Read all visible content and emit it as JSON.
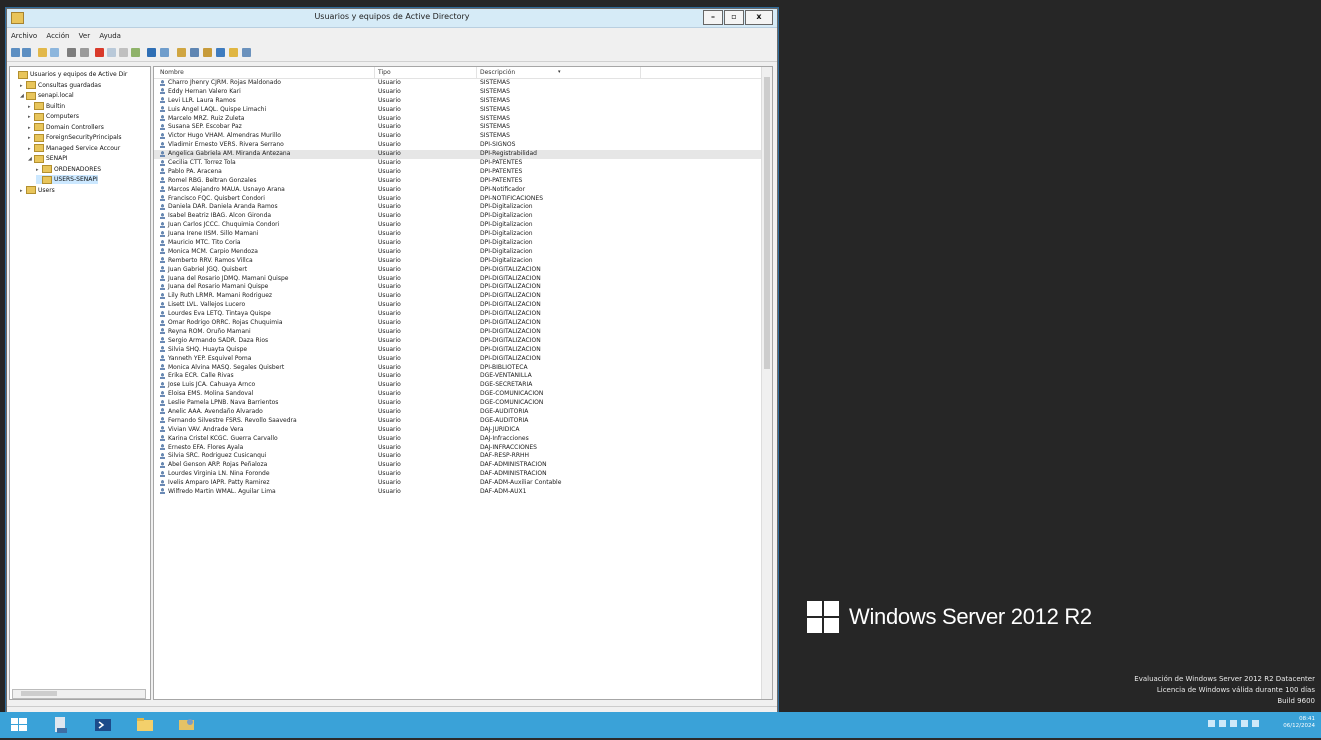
{
  "window": {
    "title": "Usuarios y equipos de Active Directory",
    "controls": {
      "minimize": "–",
      "maximize": "▫",
      "close": "x"
    }
  },
  "menu": [
    "Archivo",
    "Acción",
    "Ver",
    "Ayuda"
  ],
  "toolbar_icons": [
    "back-icon",
    "forward-icon",
    "folder-up-icon",
    "show-hide-tree-icon",
    "properties-icon",
    "copy-icon",
    "delete-icon",
    "refresh-icon",
    "export-icon",
    "help-icon",
    "filter-icon",
    "find-icon",
    "new-user-icon",
    "new-group-icon",
    "new-ou-icon",
    "filter-options-icon",
    "add-to-group-icon",
    "delegate-icon"
  ],
  "tree": {
    "items": [
      {
        "label": "Usuarios y equipos de Active Dir",
        "indent": 0,
        "expander": "",
        "selected": false
      },
      {
        "label": "Consultas guardadas",
        "indent": 1,
        "expander": "▸",
        "selected": false
      },
      {
        "label": "senapi.local",
        "indent": 1,
        "expander": "◢",
        "selected": false
      },
      {
        "label": "Builtin",
        "indent": 2,
        "expander": "▸",
        "selected": false
      },
      {
        "label": "Computers",
        "indent": 2,
        "expander": "▸",
        "selected": false
      },
      {
        "label": "Domain Controllers",
        "indent": 2,
        "expander": "▸",
        "selected": false
      },
      {
        "label": "ForeignSecurityPrincipals",
        "indent": 2,
        "expander": "▸",
        "selected": false
      },
      {
        "label": "Managed Service Accour",
        "indent": 2,
        "expander": "▸",
        "selected": false
      },
      {
        "label": "SENAPI",
        "indent": 2,
        "expander": "◢",
        "selected": false
      },
      {
        "label": "ORDENADORES",
        "indent": 3,
        "expander": "▸",
        "selected": false
      },
      {
        "label": "USERS-SENAPI",
        "indent": 3,
        "expander": "",
        "selected": true
      },
      {
        "label": "Users",
        "indent": 1,
        "expander": "▸",
        "selected": false
      }
    ]
  },
  "list": {
    "columns": {
      "name": "Nombre",
      "type": "Tipo",
      "desc": "Descripción"
    },
    "rows": [
      {
        "name": "Charro Jhenry CJRM. Rojas Maldonado",
        "type": "Usuario",
        "desc": "SISTEMAS"
      },
      {
        "name": "Eddy Hernan Valero Kari",
        "type": "Usuario",
        "desc": "SISTEMAS"
      },
      {
        "name": "Levi LLR. Laura Ramos",
        "type": "Usuario",
        "desc": "SISTEMAS"
      },
      {
        "name": "Luis Angel LAQL. Quispe Limachi",
        "type": "Usuario",
        "desc": "SISTEMAS"
      },
      {
        "name": "Marcelo MRZ. Ruiz Zuleta",
        "type": "Usuario",
        "desc": "SISTEMAS"
      },
      {
        "name": "Susana SEP. Escobar Paz",
        "type": "Usuario",
        "desc": "SISTEMAS"
      },
      {
        "name": "Victor Hugo VHAM. Almendras Murillo",
        "type": "Usuario",
        "desc": "SISTEMAS"
      },
      {
        "name": "Vladimir Ernesto VERS. Rivera Serrano",
        "type": "Usuario",
        "desc": "DPI-SIGNOS"
      },
      {
        "name": "Angelica Gabriela AM. Miranda Antezana",
        "type": "Usuario",
        "desc": "DPI-Registrabilidad"
      },
      {
        "name": "Cecilia CTT. Torrez Tola",
        "type": "Usuario",
        "desc": "DPI-PATENTES"
      },
      {
        "name": "Pablo PA. Aracena",
        "type": "Usuario",
        "desc": "DPI-PATENTES"
      },
      {
        "name": "Romel RBG. Beltran Gonzales",
        "type": "Usuario",
        "desc": "DPI-PATENTES"
      },
      {
        "name": "Marcos Alejandro MAUA. Usnayo Arana",
        "type": "Usuario",
        "desc": "DPI-Notificador"
      },
      {
        "name": "Francisco FQC. Quisbert Condori",
        "type": "Usuario",
        "desc": "DPI-NOTIFICACIONES"
      },
      {
        "name": "Daniela DAR. Daniela Aranda Ramos",
        "type": "Usuario",
        "desc": "DPI-Digitalizacion"
      },
      {
        "name": "Isabel Beatriz IBAG. Alcon Gironda",
        "type": "Usuario",
        "desc": "DPI-Digitalizacion"
      },
      {
        "name": "Juan Carlos JCCC. Chuquimia Condori",
        "type": "Usuario",
        "desc": "DPI-Digitalizacion"
      },
      {
        "name": "Juana Irene IISM. Sillo Mamani",
        "type": "Usuario",
        "desc": "DPI-Digitalizacion"
      },
      {
        "name": "Mauricio MTC. Tito Coria",
        "type": "Usuario",
        "desc": "DPI-Digitalizacion"
      },
      {
        "name": "Monica MCM. Carpio Mendoza",
        "type": "Usuario",
        "desc": "DPI-Digitalizacion"
      },
      {
        "name": "Remberto RRV. Ramos Villca",
        "type": "Usuario",
        "desc": "DPI-Digitalizacion"
      },
      {
        "name": "Juan Gabriel JGQ. Quisbert",
        "type": "Usuario",
        "desc": "DPI-DIGITALIZACION"
      },
      {
        "name": "Juana del Rosario JDMQ. Mamani Quispe",
        "type": "Usuario",
        "desc": "DPI-DIGITALIZACION"
      },
      {
        "name": "Juana del Rosario Mamani Quispe",
        "type": "Usuario",
        "desc": "DPI-DIGITALIZACION"
      },
      {
        "name": "Lily Ruth LRMR. Mamani Rodriguez",
        "type": "Usuario",
        "desc": "DPI-DIGITALIZACION"
      },
      {
        "name": "Lisett LVL. Vallejos Lucero",
        "type": "Usuario",
        "desc": "DPI-DIGITALIZACION"
      },
      {
        "name": "Lourdes Eva LETQ. Tintaya Quispe",
        "type": "Usuario",
        "desc": "DPI-DIGITALIZACION"
      },
      {
        "name": "Omar Rodrigo ORRC. Rojas Chuquimia",
        "type": "Usuario",
        "desc": "DPI-DIGITALIZACION"
      },
      {
        "name": "Reyna ROM. Oruño Mamani",
        "type": "Usuario",
        "desc": "DPI-DIGITALIZACION"
      },
      {
        "name": "Sergio Armando SADR. Daza Rios",
        "type": "Usuario",
        "desc": "DPI-DIGITALIZACION"
      },
      {
        "name": "Silvia SHQ. Huayta Quispe",
        "type": "Usuario",
        "desc": "DPI-DIGITALIZACION"
      },
      {
        "name": "Yanneth YEP. Esquivel Poma",
        "type": "Usuario",
        "desc": "DPI-DIGITALIZACION"
      },
      {
        "name": "Monica Alvina MASQ. Segales Quisbert",
        "type": "Usuario",
        "desc": "DPI-BIBLIOTECA"
      },
      {
        "name": "Erika ECR. Calle Rivas",
        "type": "Usuario",
        "desc": "DGE-VENTANILLA"
      },
      {
        "name": "Jose Luis JCA. Cahuaya Arnco",
        "type": "Usuario",
        "desc": "DGE-SECRETARIA"
      },
      {
        "name": "Eloisa EMS. Molina Sandoval",
        "type": "Usuario",
        "desc": "DGE-COMUNICACION"
      },
      {
        "name": "Leslie Pamela LPNB. Nava Barrientos",
        "type": "Usuario",
        "desc": "DGE-COMUNICACION"
      },
      {
        "name": "Anelic AAA. Avendaño Alvarado",
        "type": "Usuario",
        "desc": "DGE-AUDITORIA"
      },
      {
        "name": "Fernando Silvestre FSRS. Revollo Saavedra",
        "type": "Usuario",
        "desc": "DGE-AUDITORIA"
      },
      {
        "name": "Vivian VAV. Andrade Vera",
        "type": "Usuario",
        "desc": "DAJ-JURIDICA"
      },
      {
        "name": "Karina Cristel KCGC. Guerra Carvallo",
        "type": "Usuario",
        "desc": "DAJ-Infracciones"
      },
      {
        "name": "Ernesto EFA. Flores Ayala",
        "type": "Usuario",
        "desc": "DAJ-INFRACCIONES"
      },
      {
        "name": "Silvia SRC. Rodriguez Cusicanqui",
        "type": "Usuario",
        "desc": "DAF-RESP-RRHH"
      },
      {
        "name": "Abel Genson ARP. Rojas Peñaloza",
        "type": "Usuario",
        "desc": "DAF-ADMINISTRACION"
      },
      {
        "name": "Lourdes Virginia LN. Nina Foronde",
        "type": "Usuario",
        "desc": "DAF-ADMINISTRACION"
      },
      {
        "name": "Ivelis Amparo IAPR. Patty Ramirez",
        "type": "Usuario",
        "desc": "DAF-ADM-Auxiliar Contable"
      },
      {
        "name": "Wilfredo Martin WMAL. Aguilar Lima",
        "type": "Usuario",
        "desc": "DAF-ADM-AUX1"
      }
    ],
    "highlighted_row": 8
  },
  "desktop": {
    "brand": "Windows Server 2012 R2",
    "watermark": [
      "Evaluación de Windows Server 2012 R2 Datacenter",
      "Licencia de Windows válida durante 100 días",
      "Build 9600"
    ]
  },
  "taskbar": {
    "buttons": [
      "start-button",
      "server-manager-button",
      "powershell-button",
      "file-explorer-button",
      "ad-users-button"
    ],
    "clock_time": "08:41",
    "clock_date": "06/12/2024"
  },
  "colors": {
    "taskbar": "#3aa2d8",
    "desktop": "#262626",
    "titlebar": "#d6ebf7",
    "folder": "#e8c55b"
  }
}
